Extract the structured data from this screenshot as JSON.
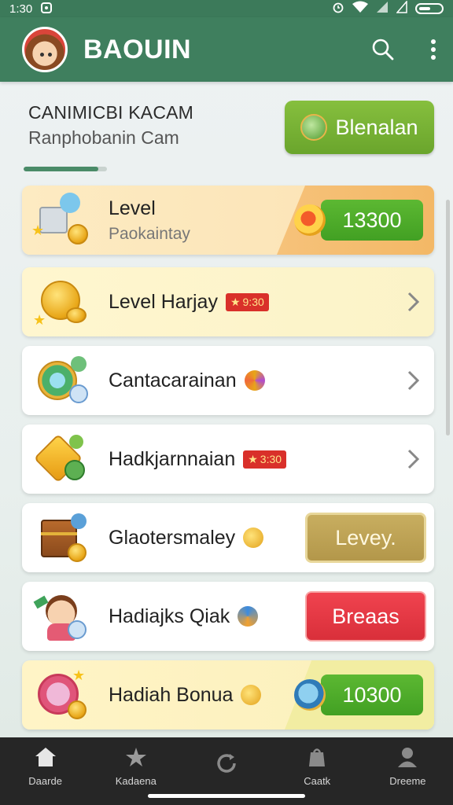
{
  "status_bar": {
    "time": "1:30"
  },
  "app_bar": {
    "title": "BAOUIN"
  },
  "header": {
    "title": "CANIMICBI KACAM",
    "subtitle": "Ranphobanin Cam",
    "button_label": "Blenalan",
    "progress": 0.9
  },
  "rows": [
    {
      "title": "Level",
      "subtitle": "Paokaintay",
      "action_label": "13300"
    },
    {
      "title": "Level Harjay",
      "badge": "9:30"
    },
    {
      "title": "Cantacarainan"
    },
    {
      "title": "Hadkjarnnaian",
      "badge": "3:30"
    },
    {
      "title": "Glaotersmaley",
      "action_label": "Levey."
    },
    {
      "title": "Hadiajks Qiak",
      "action_label": "Breaas"
    },
    {
      "title": "Hadiah Bonua",
      "action_label": "10300"
    }
  ],
  "nav": [
    {
      "label": "Daarde",
      "icon": "home-icon"
    },
    {
      "label": "Kadaena",
      "icon": "star-icon"
    },
    {
      "label": "",
      "icon": "refresh-icon"
    },
    {
      "label": "Caatk",
      "icon": "bag-icon"
    },
    {
      "label": "Dreeme",
      "icon": "profile-icon"
    }
  ],
  "colors": {
    "app_bar": "#3f7f5e",
    "accent_green": "#6aa52c",
    "action_red": "#d92f3a",
    "nav_bg": "#262626"
  }
}
